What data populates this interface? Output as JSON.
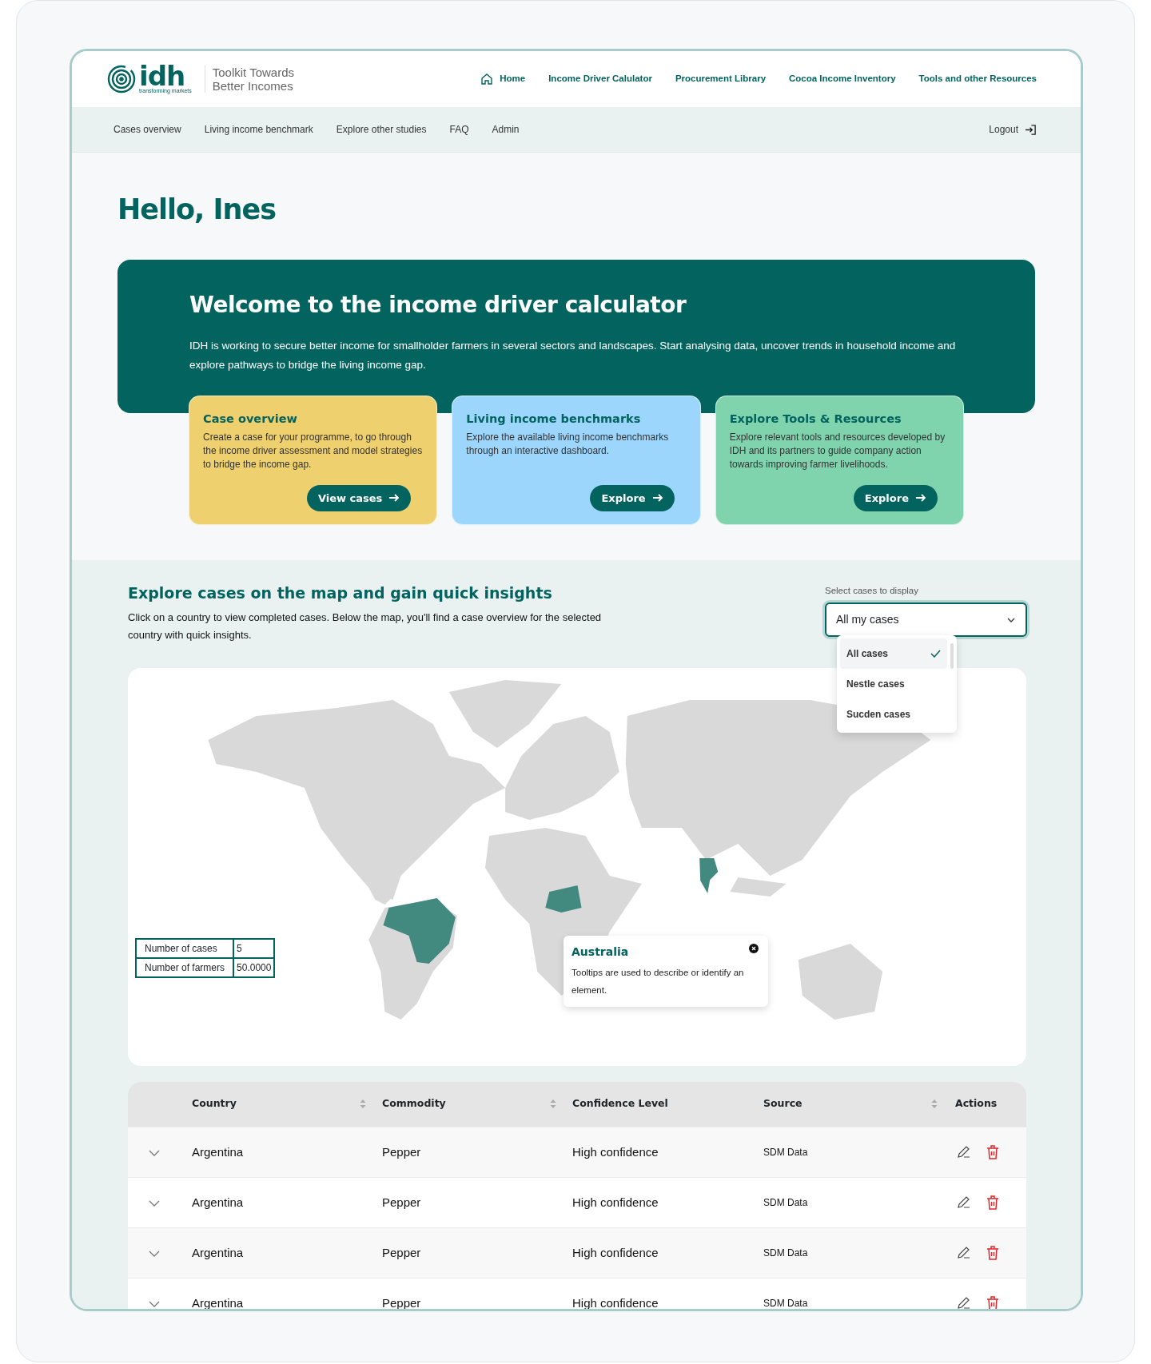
{
  "logo": {
    "wordmark": "idh",
    "tagline": "transforming markets"
  },
  "app_title": [
    "Toolkit Towards",
    "Better Incomes"
  ],
  "main_nav": [
    {
      "label": "Home",
      "kind": "home"
    },
    {
      "label": "Income Driver Calulator",
      "kind": "link"
    },
    {
      "label": "Procurement Library",
      "kind": "link"
    },
    {
      "label": "Cocoa Income Inventory",
      "kind": "link"
    },
    {
      "label": "Tools and other Resources",
      "kind": "link"
    }
  ],
  "sub_nav": [
    "Cases overview",
    "Living income benchmark",
    "Explore other studies",
    "FAQ",
    "Admin"
  ],
  "logout": "Logout",
  "greeting": "Hello, Ines",
  "banner": {
    "title": "Welcome to the income driver calculator",
    "text": "IDH is working to secure better income for smallholder farmers in several sectors and landscapes. Start analysing data, uncover trends in household income and explore pathways to bridge the living income gap."
  },
  "cards": [
    {
      "title": "Case overview",
      "text": "Create a case for your programme, to go through the income driver assessment and model strategies to bridge the income gap.",
      "button": "View cases",
      "color": "#efd06f"
    },
    {
      "title": "Living income benchmarks",
      "text": "Explore the available living income benchmarks through an interactive dashboard.",
      "button": "Explore",
      "color": "#9dd6fd"
    },
    {
      "title": "Explore Tools & Resources",
      "text": "Explore relevant tools and resources developed by IDH and its partners to guide company action towards improving farmer livelihoods.",
      "button": "Explore",
      "color": "#7fd4ad"
    }
  ],
  "map_section": {
    "title": "Explore cases on the map and gain quick insights",
    "description": "Click on a country to view completed cases. Below the map, you'll find a case overview for the selected country with quick insights.",
    "select": {
      "label": "Select cases to display",
      "value": "All my cases",
      "expanded": true,
      "options": [
        {
          "label": "All cases",
          "selected": true
        },
        {
          "label": "Nestle cases",
          "selected": false
        },
        {
          "label": "Sucden cases",
          "selected": false
        }
      ]
    }
  },
  "map": {
    "stats": [
      {
        "label": "Number of cases",
        "value": "5"
      },
      {
        "label": "Number of farmers",
        "value": "50.0000"
      }
    ],
    "tooltip": {
      "title": "Australia",
      "text": "Tooltips are used to describe or identify an element."
    }
  },
  "table": {
    "columns": [
      {
        "label": "Country",
        "sortable": true
      },
      {
        "label": "Commodity",
        "sortable": true
      },
      {
        "label": "Confidence Level",
        "sortable": false
      },
      {
        "label": "Source",
        "sortable": true
      },
      {
        "label": "Actions",
        "sortable": false
      }
    ],
    "rows": [
      {
        "country": "Argentina",
        "commodity": "Pepper",
        "confidence": "High confidence",
        "source": "SDM Data"
      },
      {
        "country": "Argentina",
        "commodity": "Pepper",
        "confidence": "High confidence",
        "source": "SDM Data"
      },
      {
        "country": "Argentina",
        "commodity": "Pepper",
        "confidence": "High confidence",
        "source": "SDM Data"
      },
      {
        "country": "Argentina",
        "commodity": "Pepper",
        "confidence": "High confidence",
        "source": "SDM Data"
      }
    ]
  }
}
